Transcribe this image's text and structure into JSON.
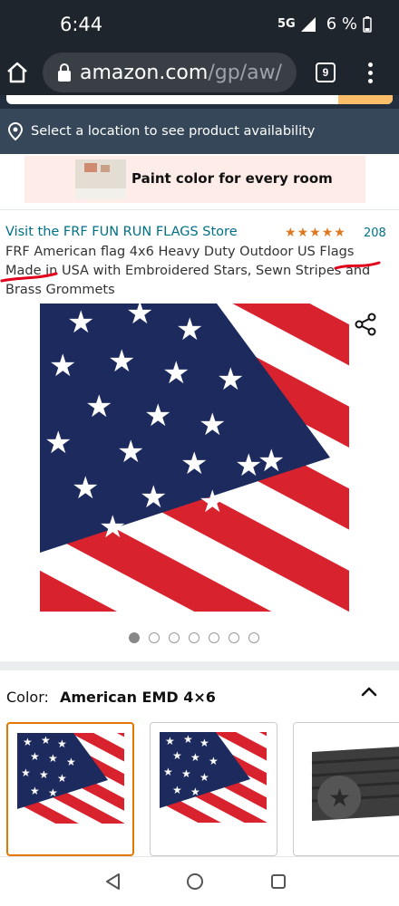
{
  "status_bar": {
    "time": "6:44",
    "network": "5G",
    "battery": "6 %"
  },
  "browser": {
    "url_host": "amazon.com",
    "url_path": "/gp/aw/",
    "tab_count": "9"
  },
  "location": {
    "text": "Select a location to see product availability"
  },
  "ad_banner": {
    "text": "Paint color for every room"
  },
  "product": {
    "store_link": "Visit the FRF FUN RUN FLAGS Store",
    "rating_count": "208",
    "rating": 5,
    "title_part1": "FRF American flag 4x6 Heavy Duty Outdoor US Flags ",
    "title_made": "Made",
    "title_part2": " in USA with Embroidered Stars, Sewn Stripes and Brass Grommets"
  },
  "carousel": {
    "count": 7,
    "active_index": 1
  },
  "variation": {
    "label": "Color:",
    "selected": "American EMD 4×6"
  },
  "icons": {
    "home": "home-icon",
    "lock": "lock-icon",
    "menu": "more-vert-icon",
    "pin": "location-pin-icon",
    "share": "share-icon",
    "chevron": "chevron-up-icon",
    "back": "nav-back-icon",
    "nav_home": "nav-home-icon",
    "recent": "nav-recent-icon"
  },
  "colors": {
    "amazon_dark": "#232f3e",
    "location_bar": "#37475a",
    "link": "#007185",
    "star": "#de7921",
    "selected_border": "#e77600",
    "flag_red": "#d8232f",
    "flag_blue": "#1d2a5e"
  }
}
